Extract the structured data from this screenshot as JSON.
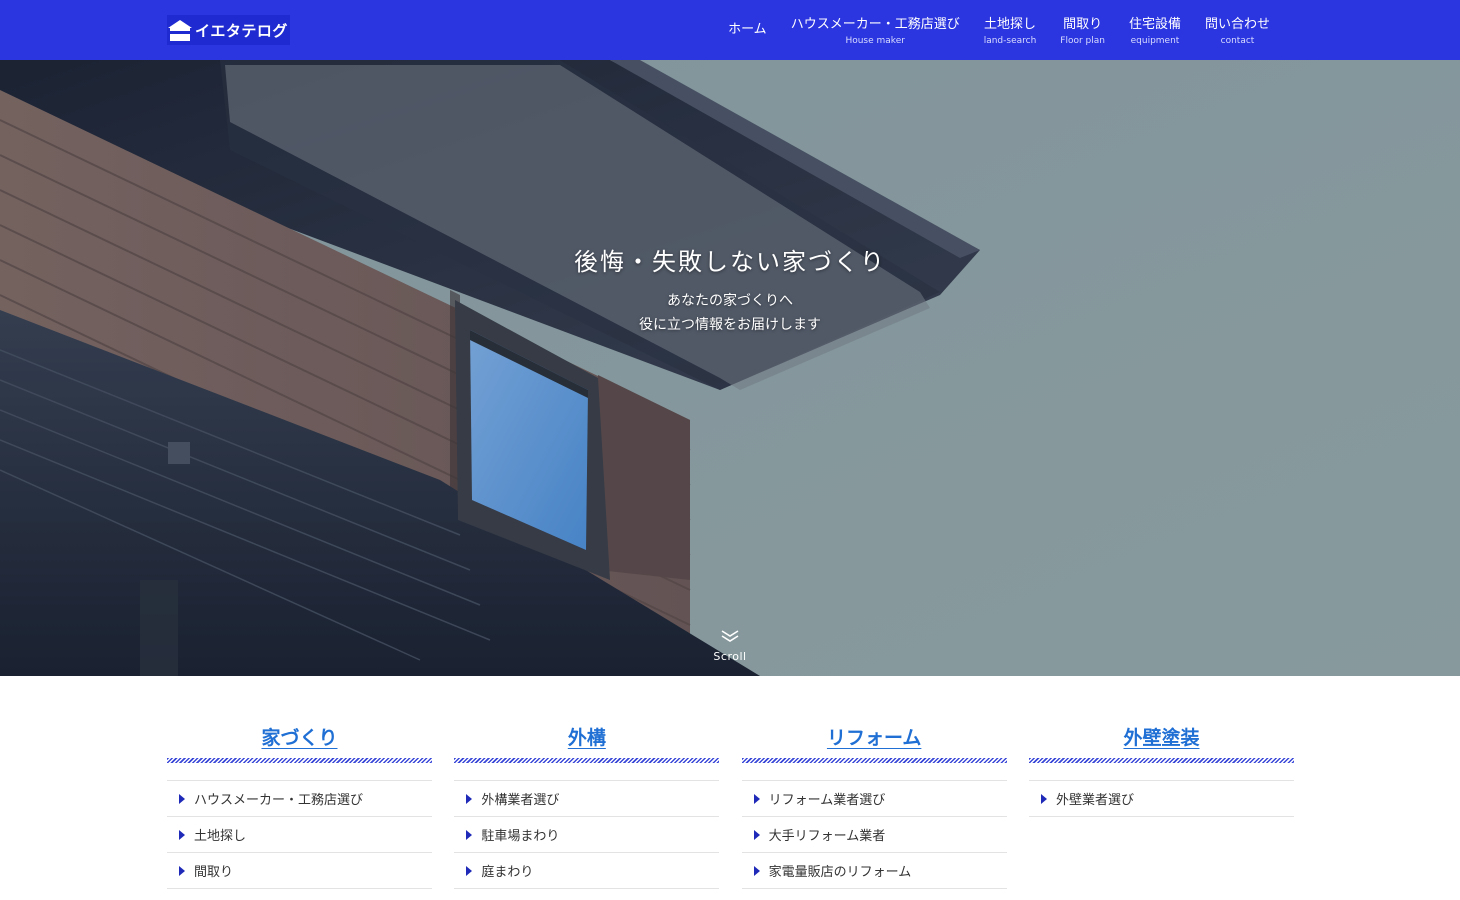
{
  "header": {
    "logo_text": "イエタテログ",
    "nav": [
      {
        "label": "ホーム",
        "sub": ""
      },
      {
        "label": "ハウスメーカー・工務店選び",
        "sub": "House maker"
      },
      {
        "label": "土地探し",
        "sub": "land-search"
      },
      {
        "label": "間取り",
        "sub": "Floor plan"
      },
      {
        "label": "住宅設備",
        "sub": "equipment"
      },
      {
        "label": "問い合わせ",
        "sub": "contact"
      }
    ]
  },
  "hero": {
    "title": "後悔・失敗しない家づくり",
    "subtitle_line1": "あなたの家づくりへ",
    "subtitle_line2": "役に立つ情報をお届けします",
    "scroll_label": "Scroll"
  },
  "categories": [
    {
      "title": "家づくり",
      "items": [
        "ハウスメーカー・工務店選び",
        "土地探し",
        "間取り"
      ]
    },
    {
      "title": "外構",
      "items": [
        "外構業者選び",
        "駐車場まわり",
        "庭まわり"
      ]
    },
    {
      "title": "リフォーム",
      "items": [
        "リフォーム業者選び",
        "大手リフォーム業者",
        "家電量販店のリフォーム"
      ]
    },
    {
      "title": "外壁塗装",
      "items": [
        "外壁業者選び"
      ]
    }
  ],
  "colors": {
    "header_bg": "#2b35e0",
    "category_title": "#1f6fd4",
    "bullet": "#1f2bb8"
  }
}
